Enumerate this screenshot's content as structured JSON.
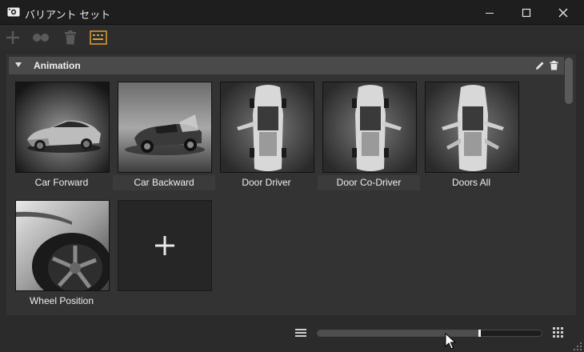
{
  "window": {
    "title": "バリアント セット"
  },
  "toolbar": {
    "icons": [
      "add-icon",
      "variant-group-icon",
      "trash-icon",
      "settings-panel-icon"
    ],
    "accent_color": "#e0a030"
  },
  "section": {
    "title": "Animation",
    "icons": [
      "edit-pencil-icon",
      "delete-icon"
    ]
  },
  "items": [
    {
      "label": "Car Forward"
    },
    {
      "label": "Car Backward"
    },
    {
      "label": "Door Driver"
    },
    {
      "label": "Door Co-Driver"
    },
    {
      "label": "Doors All"
    },
    {
      "label": "Wheel Position"
    }
  ],
  "footer": {
    "thumbnail_size_fraction": 0.72,
    "icons": [
      "list-view-icon",
      "grid-view-icon"
    ]
  }
}
